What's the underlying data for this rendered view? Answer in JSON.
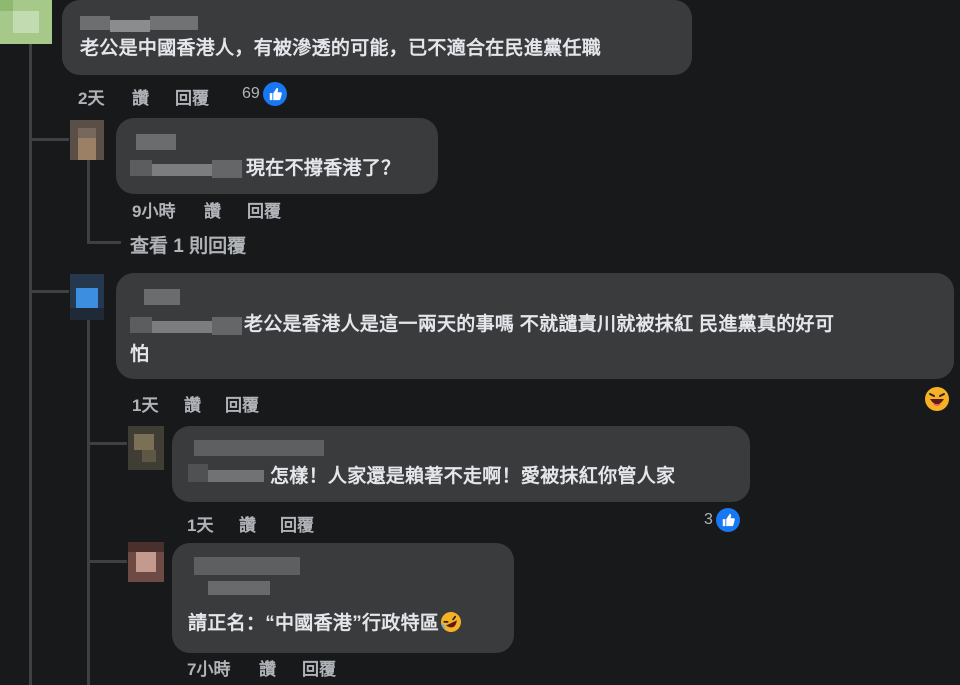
{
  "comments": [
    {
      "text": "老公是中國香港人，有被滲透的可能，已不適合在民進黨任職",
      "time": "2天",
      "like_label": "讚",
      "reply_label": "回覆",
      "reaction_count": "69",
      "reaction_icon": "like-icon",
      "avatar_color": "#a6c98a"
    },
    {
      "text": "現在不撐香港了？",
      "time": "9小時",
      "like_label": "讚",
      "reply_label": "回覆",
      "avatar_color": "#9b8066"
    },
    {
      "view_replies": "查看 1 則回覆"
    },
    {
      "text_line1": "老公是香港人是這一兩天的事嗎 不就譴責川就被抹紅 民進黨真的好可",
      "text_line2": "怕",
      "time": "1天",
      "like_label": "讚",
      "reply_label": "回覆",
      "reaction_icon": "haha-emoji-icon",
      "avatar_color": "#3b8ee0"
    },
    {
      "text": "怎樣！人家還是賴著不走啊！愛被抹紅你管人家",
      "time": "1天",
      "like_label": "讚",
      "reply_label": "回覆",
      "reaction_count": "3",
      "reaction_icon": "like-icon",
      "avatar_color": "#7a7055"
    },
    {
      "text": "請正名：“中國香港”行政特區",
      "text_emoji": "rofl-emoji-icon",
      "time": "7小時",
      "like_label": "讚",
      "reply_label": "回覆",
      "avatar_color": "#c49a8e"
    }
  ],
  "colors": {
    "background": "#18191a",
    "bubble": "#3a3b3c",
    "text": "#e4e6eb",
    "secondary_text": "#b0b3b8",
    "like_blue": "#1877f2"
  }
}
